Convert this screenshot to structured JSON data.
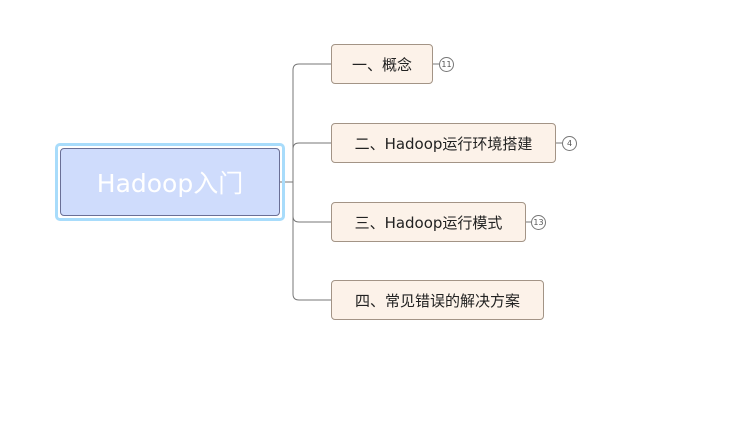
{
  "root": {
    "label": "Hadoop入门"
  },
  "topics": [
    {
      "label": "一、概念",
      "count": "11"
    },
    {
      "label": "二、Hadoop运行环境搭建",
      "count": "4"
    },
    {
      "label": "三、Hadoop运行模式",
      "count": "13"
    },
    {
      "label": "四、常见错误的解决方案"
    }
  ]
}
